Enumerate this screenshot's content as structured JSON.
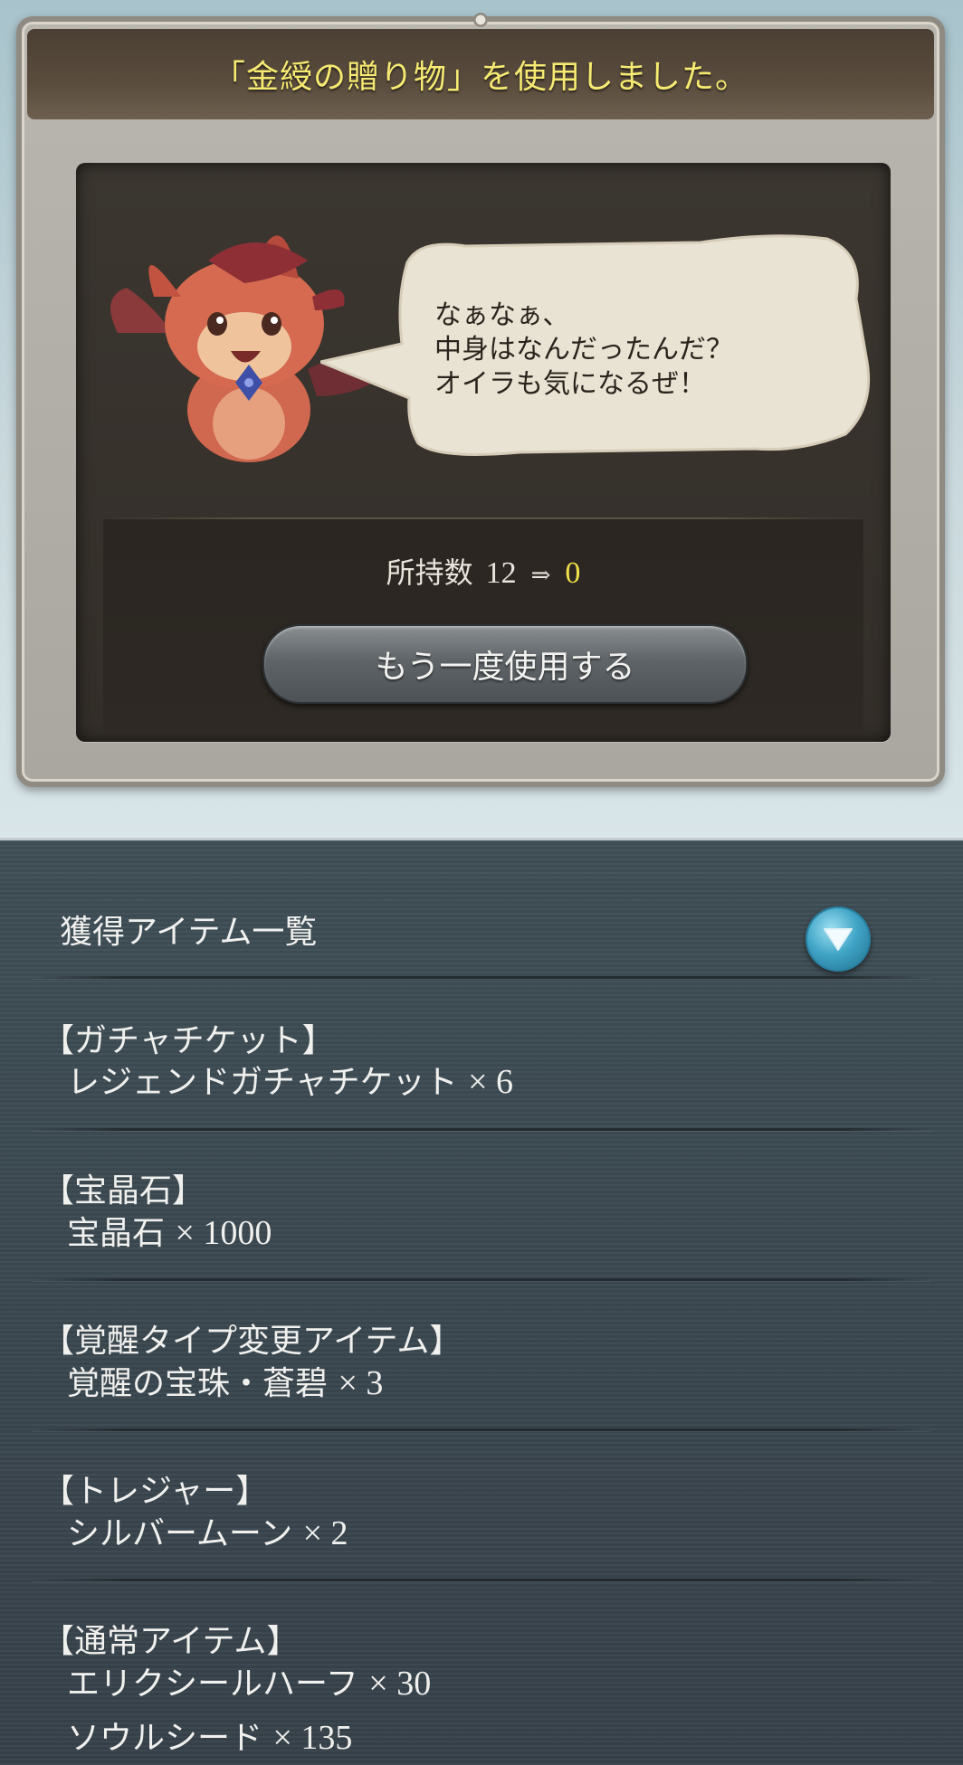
{
  "dialog": {
    "title": "「金綬の贈り物」を使用しました。",
    "bubble_lines": [
      "なぁなぁ、",
      "中身はなんだったんだ？",
      "オイラも気になるぜ！"
    ],
    "count_label": "所持数",
    "count_before": "12",
    "count_arrow": "⇒",
    "count_after": "0",
    "reuse_button": "もう一度使用する"
  },
  "list": {
    "title": "獲得アイテム一覧",
    "toggle_icon": "chevron-down-icon",
    "groups": [
      {
        "category": "【ガチャチケット】",
        "items": [
          {
            "name": "レジェンドガチャチケット",
            "qty": "× 6"
          }
        ]
      },
      {
        "category": "【宝晶石】",
        "items": [
          {
            "name": "宝晶石",
            "qty": "× 1000"
          }
        ]
      },
      {
        "category": "【覚醒タイプ変更アイテム】",
        "items": [
          {
            "name": "覚醒の宝珠・蒼碧",
            "qty": "× 3"
          }
        ]
      },
      {
        "category": "【トレジャー】",
        "items": [
          {
            "name": "シルバームーン",
            "qty": "× 2"
          }
        ]
      },
      {
        "category": "【通常アイテム】",
        "items": [
          {
            "name": "エリクシールハーフ",
            "qty": "× 30"
          },
          {
            "name": "ソウルシード",
            "qty": "× 135"
          }
        ]
      }
    ]
  },
  "colors": {
    "title_yellow": "#f6ea72",
    "count_after_yellow": "#f2e04a",
    "toggle_blue": "#3fa4c6"
  }
}
